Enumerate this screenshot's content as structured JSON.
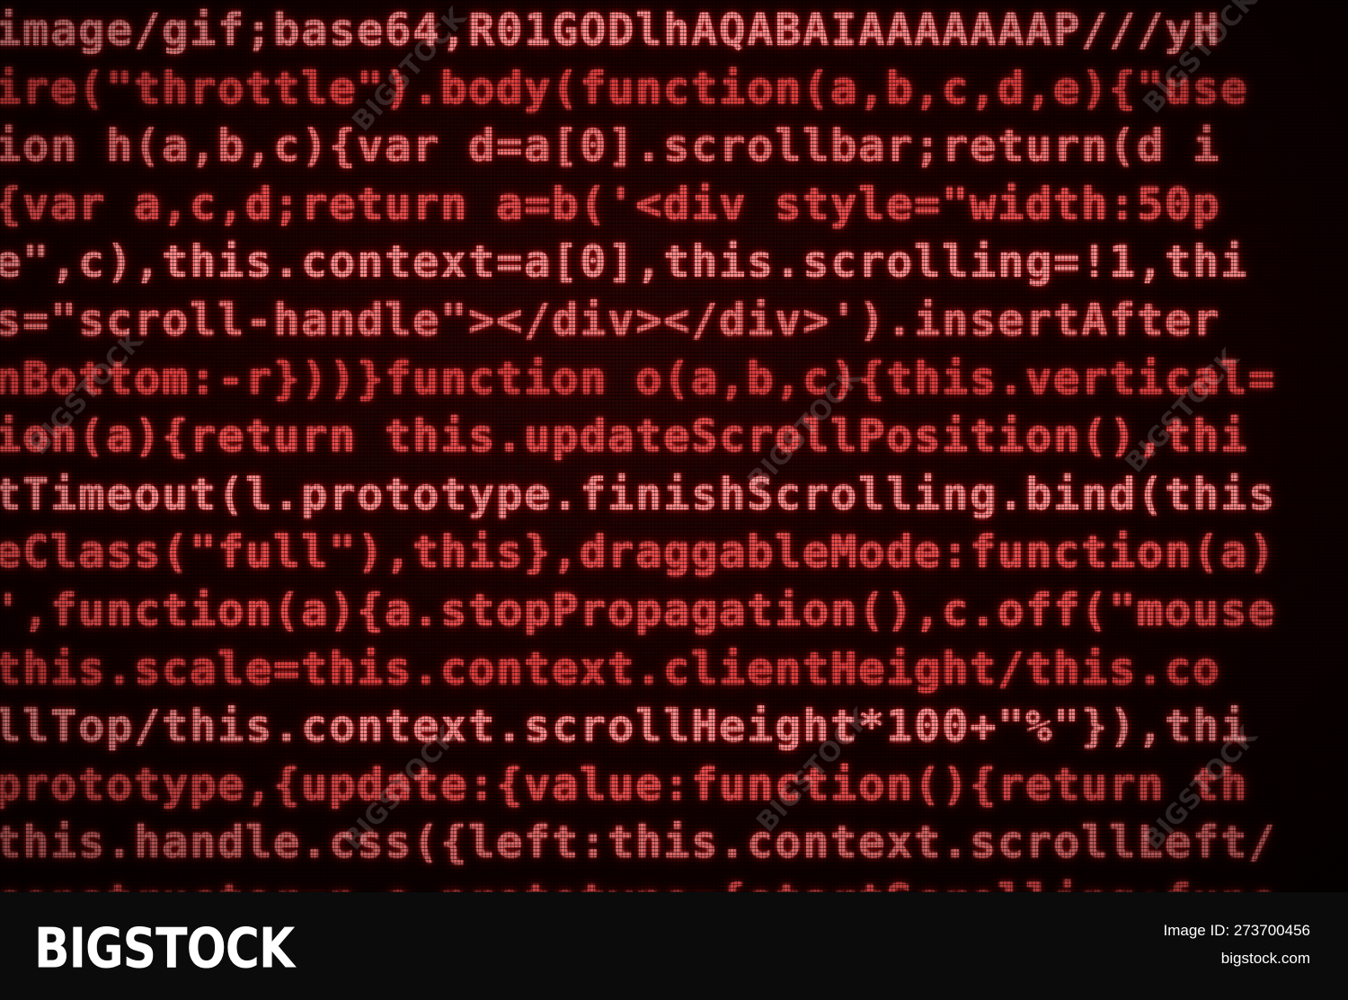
{
  "photo": {
    "code_lines": [
      "image/gif;base64,R01GODlhAQABAIAAAAAAAP///yH",
      "ire(\"throttle\").body(function(a,b,c,d,e){\"use",
      "ion h(a,b,c){var d=a[0].scrollbar;return(d i",
      "{var a,c,d;return a=b('<div style=\"width:50p",
      "e\",c),this.context=a[0],this.scrolling=!1,thi",
      "s=\"scroll-handle\"></div></div>').insertAfter",
      "nBottom:-r}))}function o(a,b,c){this.vertical=",
      "ion(a){return this.updateScrollPosition(),thi",
      "tTimeout(l.prototype.finishScrolling.bind(this",
      "eClass(\"full\"),this},draggableMode:function(a)",
      "',function(a){a.stopPropagation(),c.off(\"mouse",
      "this.scale=this.context.clientHeight/this.co",
      "llTop/this.context.scrollHeight*100+\"%\"}),thi",
      "prototype,{update:{value:function(){return th",
      "this.handle.css({left:this.context.scrollLeft/",
      "constructor=n,o.prototype={startScrolling:func"
    ],
    "watermark_text": "BIGSTOCK",
    "colors": {
      "code_text": "#e84a4a",
      "code_glow": "#ff6a6a",
      "background": "#140000"
    }
  },
  "footer": {
    "brand_logo": "BIGSTOCK",
    "image_id": "Image ID: 273700456",
    "site_url": "bigstock.com",
    "colors": {
      "background": "#0b0b0b",
      "text": "#ffffff"
    }
  }
}
